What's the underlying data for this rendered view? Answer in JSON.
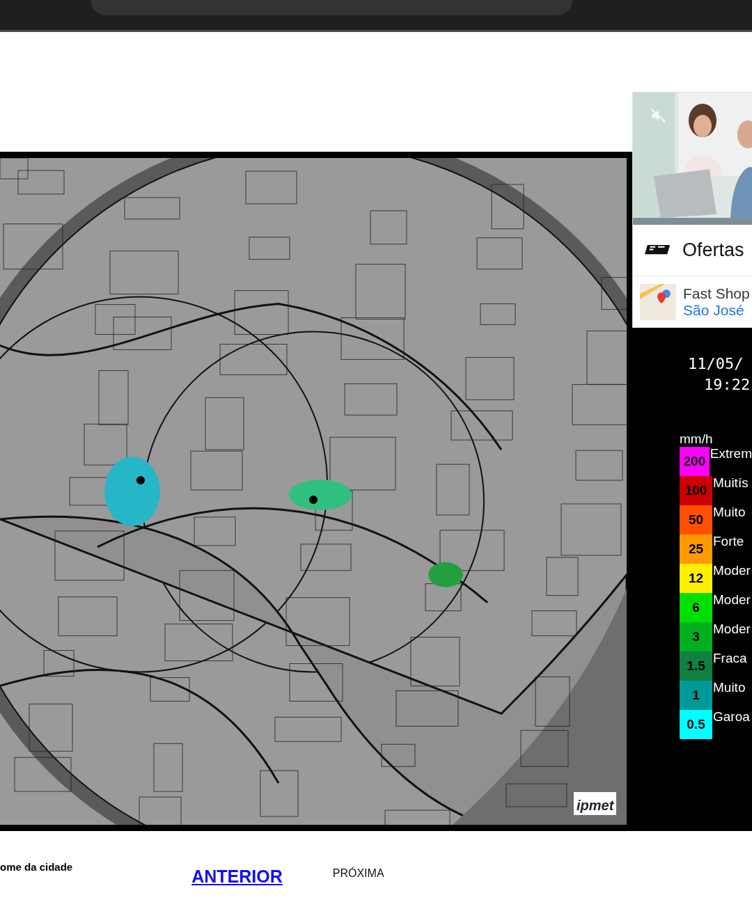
{
  "radar": {
    "date": "11/05/",
    "time": "19:22",
    "unit": "mm/h",
    "logo": "ipmet",
    "legend": [
      {
        "value": "200",
        "label": "Extrem",
        "color": "#ff00ff"
      },
      {
        "value": "100",
        "label": "Muitís",
        "color": "#cc0000"
      },
      {
        "value": "50",
        "label": "Muito",
        "color": "#ff5000"
      },
      {
        "value": "25",
        "label": "Forte",
        "color": "#ff9900"
      },
      {
        "value": "12",
        "label": "Moder",
        "color": "#ffee00"
      },
      {
        "value": "6",
        "label": "Moder",
        "color": "#00e000"
      },
      {
        "value": "3",
        "label": "Moder",
        "color": "#00b020"
      },
      {
        "value": "1.5",
        "label": "Fraca",
        "color": "#108040"
      },
      {
        "value": "1",
        "label": "Muito",
        "color": "#009999"
      },
      {
        "value": "0.5",
        "label": "Garoa",
        "color": "#00ffff"
      }
    ]
  },
  "ad": {
    "title": "Ofertas",
    "store": "Fast Shop",
    "location": "São José"
  },
  "footer": {
    "city": "ome da cidade",
    "previous": "ANTERIOR",
    "next": "PRÓXIMA"
  }
}
